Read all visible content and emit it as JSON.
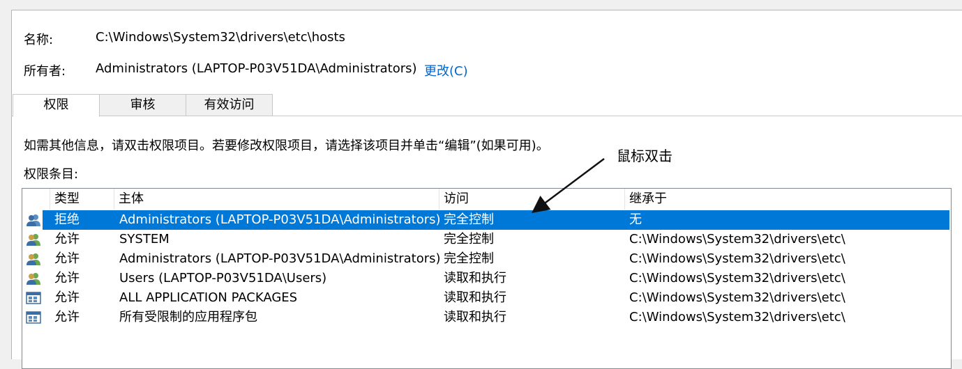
{
  "info": {
    "name_label": "名称:",
    "name_value": "C:\\Windows\\System32\\drivers\\etc\\hosts",
    "owner_label": "所有者:",
    "owner_value": "Administrators (LAPTOP-P03V51DA\\Administrators)",
    "change_link": "更改(C)"
  },
  "tabs": [
    {
      "label": "权限",
      "active": true
    },
    {
      "label": "审核",
      "active": false
    },
    {
      "label": "有效访问",
      "active": false
    }
  ],
  "instructions": "如需其他信息，请双击权限项目。若要修改权限项目，请选择该项目并单击“编辑”(如果可用)。",
  "entries_label": "权限条目:",
  "columns": [
    "类型",
    "主体",
    "访问",
    "继承于"
  ],
  "rows": [
    {
      "icon": "users-group-icon",
      "type": "拒绝",
      "principal": "Administrators (LAPTOP-P03V51DA\\Administrators)",
      "access": "完全控制",
      "inherited": "无",
      "selected": true
    },
    {
      "icon": "users-group-icon",
      "type": "允许",
      "principal": "SYSTEM",
      "access": "完全控制",
      "inherited": "C:\\Windows\\System32\\drivers\\etc\\",
      "selected": false
    },
    {
      "icon": "users-group-icon",
      "type": "允许",
      "principal": "Administrators (LAPTOP-P03V51DA\\Administrators)",
      "access": "完全控制",
      "inherited": "C:\\Windows\\System32\\drivers\\etc\\",
      "selected": false
    },
    {
      "icon": "users-group-icon",
      "type": "允许",
      "principal": "Users (LAPTOP-P03V51DA\\Users)",
      "access": "读取和执行",
      "inherited": "C:\\Windows\\System32\\drivers\\etc\\",
      "selected": false
    },
    {
      "icon": "app-package-icon",
      "type": "允许",
      "principal": "ALL APPLICATION PACKAGES",
      "access": "读取和执行",
      "inherited": "C:\\Windows\\System32\\drivers\\etc\\",
      "selected": false
    },
    {
      "icon": "app-package-icon",
      "type": "允许",
      "principal": "所有受限制的应用程序包",
      "access": "读取和执行",
      "inherited": "C:\\Windows\\System32\\drivers\\etc\\",
      "selected": false
    }
  ],
  "annotation": "鼠标双击",
  "colors": {
    "selection": "#0078d7",
    "link": "#0066cc"
  }
}
